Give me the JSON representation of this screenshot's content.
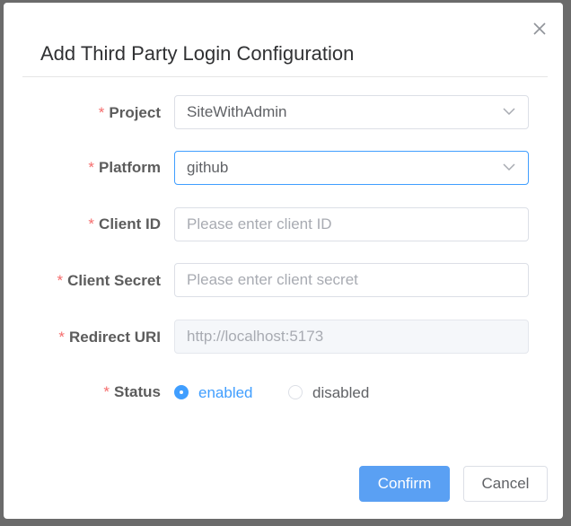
{
  "dialog": {
    "title": "Add Third Party Login Configuration",
    "close_icon": "close-icon"
  },
  "form": {
    "required_mark": "*",
    "project": {
      "label": "Project",
      "value": "SiteWithAdmin"
    },
    "platform": {
      "label": "Platform",
      "value": "github"
    },
    "client_id": {
      "label": "Client ID",
      "value": "",
      "placeholder": "Please enter client ID"
    },
    "client_secret": {
      "label": "Client Secret",
      "value": "",
      "placeholder": "Please enter client secret"
    },
    "redirect_uri": {
      "label": "Redirect URI",
      "value": "http://localhost:5173"
    },
    "status": {
      "label": "Status",
      "options": [
        {
          "label": "enabled",
          "checked": true
        },
        {
          "label": "disabled",
          "checked": false
        }
      ]
    }
  },
  "footer": {
    "confirm_label": "Confirm",
    "cancel_label": "Cancel"
  },
  "colors": {
    "accent": "#409eff",
    "required": "#f56c6c",
    "overlay": "#6b6b6b"
  }
}
